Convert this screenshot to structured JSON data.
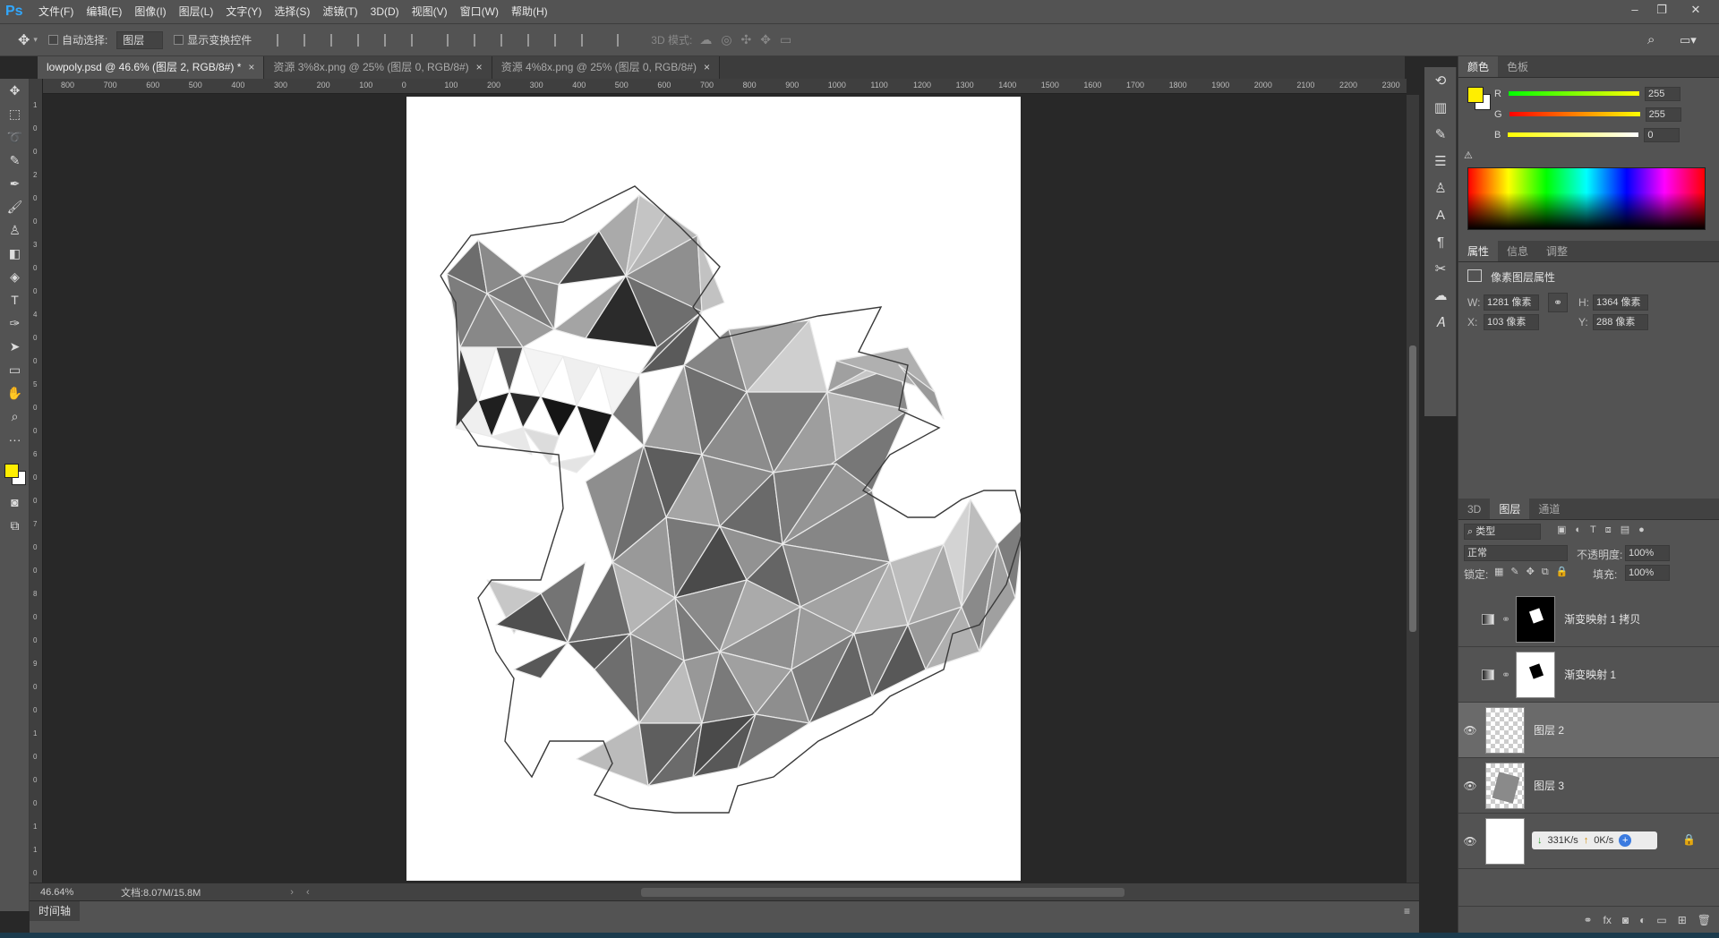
{
  "app": {
    "logo": "Ps",
    "accent": "#31a8ff"
  },
  "menu": [
    "文件(F)",
    "编辑(E)",
    "图像(I)",
    "图层(L)",
    "文字(Y)",
    "选择(S)",
    "滤镜(T)",
    "3D(D)",
    "视图(V)",
    "窗口(W)",
    "帮助(H)"
  ],
  "window_controls": {
    "minimize": "–",
    "restore": "❐",
    "close": "✕"
  },
  "options": {
    "auto_select_label": "自动选择:",
    "auto_select_value": "图层",
    "show_transform_label": "显示变换控件",
    "mode3d_label": "3D 模式:"
  },
  "tabs": [
    {
      "label": "lowpoly.psd @ 46.6% (图层 2, RGB/8#) *",
      "close": "×",
      "active": true
    },
    {
      "label": "资源 3%8x.png @ 25% (图层 0, RGB/8#)",
      "close": "×",
      "active": false
    },
    {
      "label": "资源 4%8x.png @ 25% (图层 0, RGB/8#)",
      "close": "×",
      "active": false
    }
  ],
  "ruler": {
    "top": [
      "800",
      "700",
      "600",
      "500",
      "400",
      "300",
      "200",
      "100",
      "0",
      "100",
      "200",
      "300",
      "400",
      "500",
      "600",
      "700",
      "800",
      "900",
      "1000",
      "1100",
      "1200",
      "1300",
      "1400",
      "1500",
      "1600",
      "1700",
      "1800",
      "1900",
      "2000",
      "2100",
      "2200",
      "2300"
    ],
    "left": [
      "1",
      "0",
      "0",
      "2",
      "0",
      "0",
      "3",
      "0",
      "0",
      "4",
      "0",
      "0",
      "5",
      "0",
      "0",
      "6",
      "0",
      "0",
      "7",
      "0",
      "0",
      "8",
      "0",
      "0",
      "9",
      "0",
      "0",
      "1",
      "0",
      "0",
      "0",
      "1",
      "1",
      "0",
      "0"
    ]
  },
  "status": {
    "zoom": "46.64%",
    "doc": "文档:8.07M/15.8M"
  },
  "timeline": {
    "label": "时间轴"
  },
  "color_panel": {
    "tabs": [
      "颜色",
      "色板"
    ],
    "fg": "#ffee00",
    "bg": "#ffffff",
    "channels": [
      {
        "name": "R",
        "value": "255"
      },
      {
        "name": "G",
        "value": "255"
      },
      {
        "name": "B",
        "value": "0"
      }
    ]
  },
  "properties_panel": {
    "tabs": [
      "属性",
      "信息",
      "调整"
    ],
    "title": "像素图层属性",
    "w_label": "W:",
    "w": "1281 像素",
    "h_label": "H:",
    "h": "1364 像素",
    "x_label": "X:",
    "x": "103 像素",
    "y_label": "Y:",
    "y": "288 像素"
  },
  "layers_panel": {
    "tabs": [
      "3D",
      "图层",
      "通道"
    ],
    "filter": "类型",
    "blend": "正常",
    "opacity_label": "不透明度:",
    "opacity": "100%",
    "lock_label": "锁定:",
    "fill_label": "填充:",
    "fill": "100%",
    "layers": [
      {
        "name": "渐变映射 1 拷贝",
        "visible": false
      },
      {
        "name": "渐变映射 1",
        "visible": false
      },
      {
        "name": "图层 2",
        "visible": true,
        "selected": true
      },
      {
        "name": "图层 3",
        "visible": true
      },
      {
        "name": "",
        "visible": true
      }
    ],
    "net_down": "331K/s",
    "net_up": "0K/s"
  }
}
